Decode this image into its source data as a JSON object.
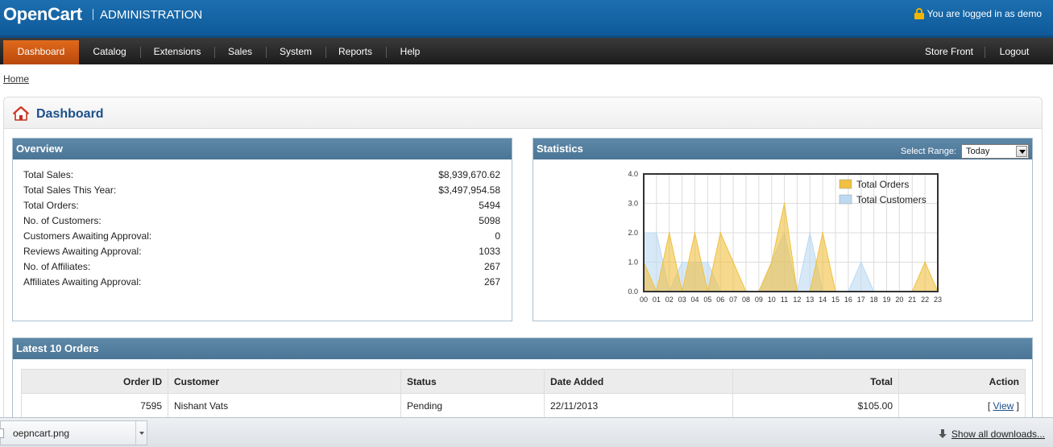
{
  "header": {
    "logo": "OpenCart",
    "subtitle": "ADMINISTRATION",
    "login_text": "You are logged in as demo"
  },
  "nav": {
    "left": [
      "Dashboard",
      "Catalog",
      "Extensions",
      "Sales",
      "System",
      "Reports",
      "Help"
    ],
    "right": [
      "Store Front",
      "Logout"
    ],
    "active": "Dashboard"
  },
  "breadcrumb": "Home",
  "page_title": "Dashboard",
  "overview": {
    "title": "Overview",
    "rows": [
      {
        "label": "Total Sales:",
        "value": "$8,939,670.62"
      },
      {
        "label": "Total Sales This Year:",
        "value": "$3,497,954.58"
      },
      {
        "label": "Total Orders:",
        "value": "5494"
      },
      {
        "label": "No. of Customers:",
        "value": "5098"
      },
      {
        "label": "Customers Awaiting Approval:",
        "value": "0"
      },
      {
        "label": "Reviews Awaiting Approval:",
        "value": "1033"
      },
      {
        "label": "No. of Affiliates:",
        "value": "267"
      },
      {
        "label": "Affiliates Awaiting Approval:",
        "value": "267"
      }
    ]
  },
  "statistics": {
    "title": "Statistics",
    "range_label": "Select Range:",
    "range_value": "Today"
  },
  "chart_data": {
    "type": "area",
    "x": [
      "00",
      "01",
      "02",
      "03",
      "04",
      "05",
      "06",
      "07",
      "08",
      "09",
      "10",
      "11",
      "12",
      "13",
      "14",
      "15",
      "16",
      "17",
      "18",
      "19",
      "20",
      "21",
      "22",
      "23"
    ],
    "ylim": [
      0,
      4
    ],
    "yticks": [
      "0.0",
      "1.0",
      "2.0",
      "3.0",
      "4.0"
    ],
    "legend_position": "top-right",
    "series": [
      {
        "name": "Total Orders",
        "color": "#f0c040",
        "values": [
          1,
          0,
          2,
          0,
          2,
          0,
          2,
          1,
          0,
          0,
          1,
          3,
          0,
          0,
          2,
          0,
          0,
          0,
          0,
          0,
          0,
          0,
          1,
          0
        ]
      },
      {
        "name": "Total Customers",
        "color": "#bcd9f2",
        "values": [
          2,
          2,
          0,
          1,
          1,
          1,
          0,
          0,
          0,
          0,
          1,
          2,
          0,
          2,
          0,
          0,
          0,
          1,
          0,
          0,
          0,
          0,
          0,
          0
        ]
      }
    ]
  },
  "orders": {
    "title": "Latest 10 Orders",
    "columns": [
      "Order ID",
      "Customer",
      "Status",
      "Date Added",
      "Total",
      "Action"
    ],
    "rows": [
      {
        "id": "7595",
        "customer": "Nishant Vats",
        "status": "Pending",
        "date": "22/11/2013",
        "total": "$105.00",
        "action_prefix": "[",
        "action": "View",
        "action_suffix": "]"
      }
    ]
  },
  "downloads": {
    "file": "oepncart.png",
    "show_all": "Show all downloads..."
  }
}
